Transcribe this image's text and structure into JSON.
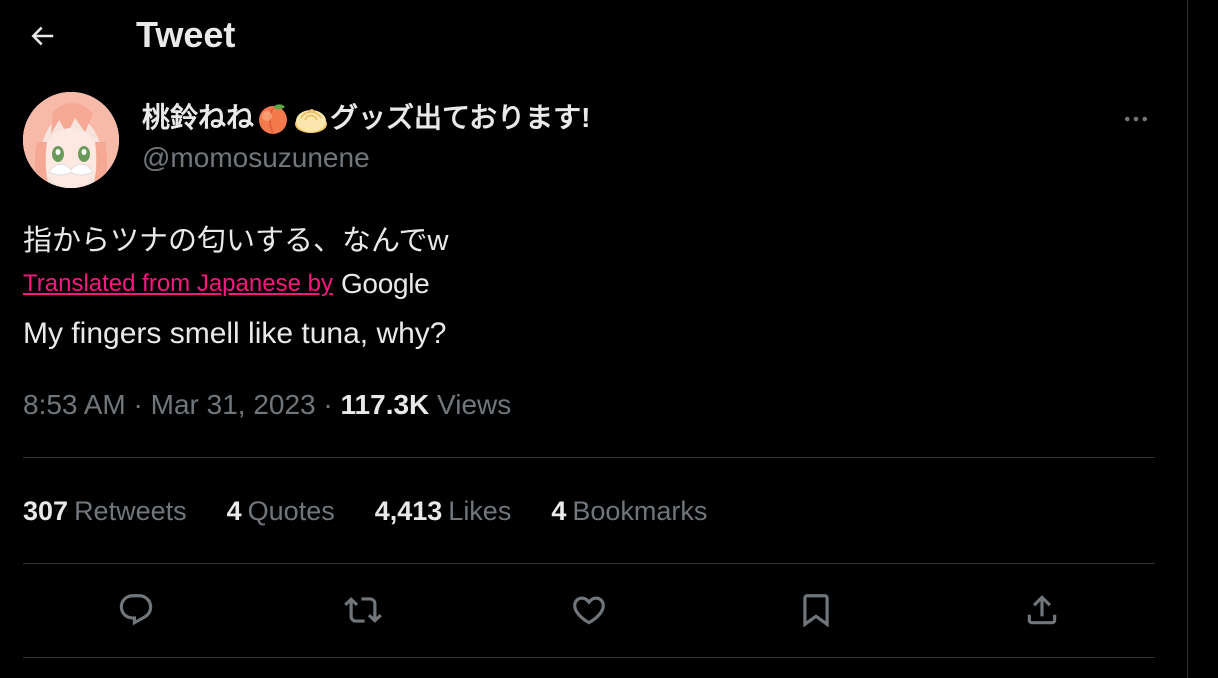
{
  "header": {
    "title": "Tweet",
    "back_icon": "arrow-left-icon"
  },
  "author": {
    "display_name_part1": "桃鈴ねね",
    "display_name_part2": "グッズ出ております!",
    "name_emojis": [
      "peach-emoji",
      "dumpling-emoji"
    ],
    "handle": "@momosuzunene"
  },
  "tweet": {
    "text": "指からツナの匂いする、なんでw",
    "translated_label": "Translated from Japanese by",
    "translator": "Google",
    "translation": "My fingers smell like tuna, why?"
  },
  "meta": {
    "time": "8:53 AM",
    "separator": "·",
    "date": "Mar 31, 2023",
    "views_count": "117.3K",
    "views_label": "Views"
  },
  "stats": [
    {
      "count": "307",
      "label": "Retweets"
    },
    {
      "count": "4",
      "label": "Quotes"
    },
    {
      "count": "4,413",
      "label": "Likes"
    },
    {
      "count": "4",
      "label": "Bookmarks"
    }
  ],
  "actions": [
    "reply-icon",
    "retweet-icon",
    "like-icon",
    "bookmark-icon",
    "share-icon"
  ],
  "colors": {
    "background": "#000000",
    "text_primary": "#e7e9ea",
    "text_secondary": "#71767b",
    "link": "#f91880",
    "divider": "#2f3336"
  }
}
